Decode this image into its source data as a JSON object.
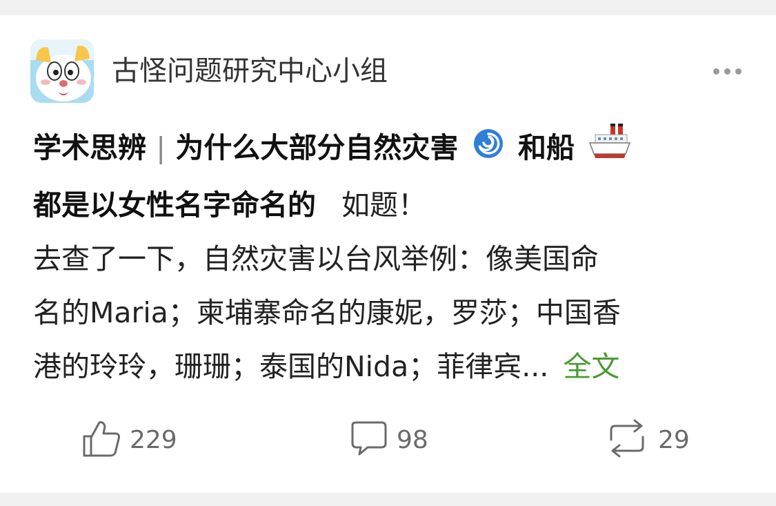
{
  "group": {
    "name": "古怪问题研究中心小组"
  },
  "post": {
    "title_prefix": "学术思辨",
    "separator": "|",
    "title_part1": "为什么大部分自然灾害",
    "title_part2": "和船",
    "title_part3": "都是以女性名字命名的",
    "inline_text": "如题！",
    "body_line1": "去查了一下，自然灾害以台风举例：像美国命",
    "body_line2": "名的Maria；柬埔寨命名的康妮，罗莎；中国香",
    "body_line3": "港的玲玲，珊珊；泰国的Nida；菲律宾...",
    "full_text_link": "全文",
    "icons": [
      "cyclone-emoji",
      "ship-emoji"
    ]
  },
  "actions": {
    "likes": "229",
    "comments": "98",
    "reposts": "29",
    "icon_color": "#6a6a6a"
  },
  "colors": {
    "link_green": "#4a9a34",
    "background": "#f0f0f0"
  }
}
